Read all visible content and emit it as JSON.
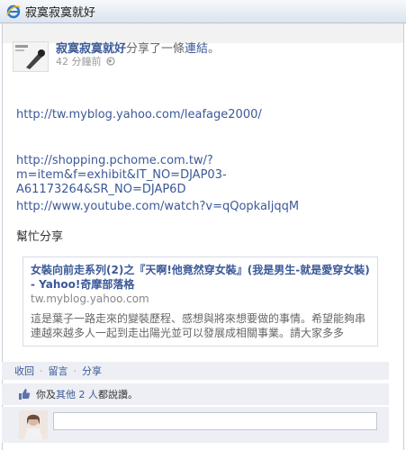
{
  "window": {
    "title": "寂寞寂寞就好"
  },
  "post": {
    "author": "寂寞寂寞就好",
    "shared_text": "分享了一條",
    "link_word": "連結",
    "period": "。",
    "time": "42 分鐘前",
    "blog_url": "http://tw.myblog.yahoo.com/leafage2000/",
    "shop_url_lines": [
      "http://shopping.pchome.com.tw/?",
      "m=item&f=exhibit&IT_NO=DJAP03-",
      "A61173264&SR_NO=DJAP6D"
    ],
    "youtube_url": "http://www.youtube.com/watch?v=qQopkaIjqqM",
    "message": "幫忙分享"
  },
  "attachment": {
    "title": "女裝向前走系列(2)之『天啊!他竟然穿女裝』(我是男生-就是愛穿女裝) - Yahoo!奇摩部落格",
    "domain": "tw.myblog.yahoo.com",
    "description": "這是葉子一路走來的變裝歷程、感想與將來想要做的事情。希望能夠串連越來越多人一起到走出陽光並可以發展成相關事業。請大家多多"
  },
  "actions": {
    "unlike": "收回",
    "comment": "留言",
    "share": "分享",
    "separator": "·"
  },
  "likes": {
    "prefix": "你及",
    "others": "其他 2 人",
    "suffix": "都說讚。"
  },
  "comment": {
    "placeholder": ""
  },
  "colors": {
    "link": "#3b5998",
    "bar": "#edeff4"
  }
}
